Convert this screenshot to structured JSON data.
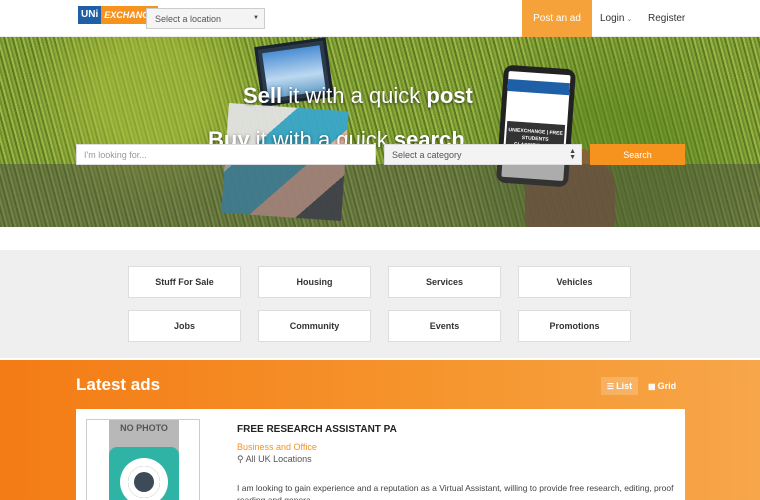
{
  "header": {
    "logo_part1": "UNi",
    "logo_part2": "EXCHANGE",
    "location_placeholder": "Select a location",
    "post_ad": "Post an ad",
    "login": "Login",
    "register": "Register"
  },
  "hero": {
    "line1_strong": "Sell",
    "line1_rest": " it with a quick ",
    "line1_end": "post",
    "line2_strong": "Buy",
    "line2_rest": " it with a quick ",
    "line2_end": "search",
    "phone_text": "UNIEXCHANGE | FREE STUDENTS CLASSIFIED ADS",
    "search_placeholder": "I'm looking for...",
    "category_placeholder": "Select a category",
    "search_button": "Search"
  },
  "categories": [
    "Stuff For Sale",
    "Housing",
    "Services",
    "Vehicles",
    "Jobs",
    "Community",
    "Events",
    "Promotions"
  ],
  "latest": {
    "title": "Latest ads",
    "list_label": "List",
    "grid_label": "Grid"
  },
  "ad": {
    "photo_label": "NO PHOTO",
    "title": "FREE RESEARCH ASSISTANT PA",
    "category": "Business and Office",
    "location": "All UK Locations",
    "description": "I am looking to gain experience and a reputation as a Virtual Assistant, willing to provide free research, editing, proof reading and genera..."
  },
  "colors": {
    "accent": "#f6921e",
    "brand_blue": "#1f5fa8"
  }
}
